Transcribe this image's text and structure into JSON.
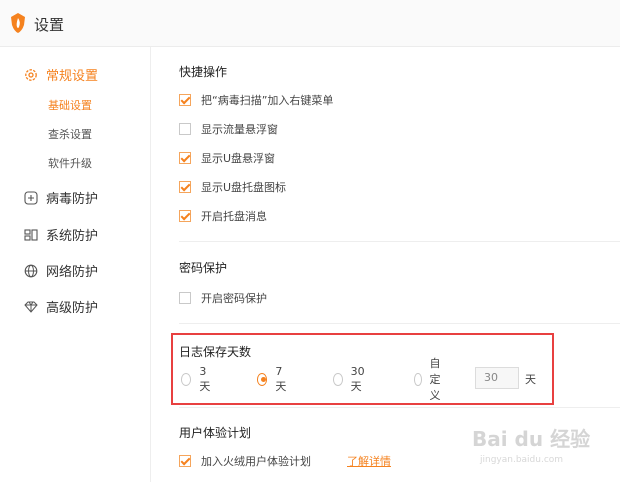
{
  "app": {
    "title": "设置"
  },
  "sidebar": {
    "items": [
      {
        "label": "常规设置",
        "icon": "gear-icon"
      },
      {
        "label": "病毒防护",
        "icon": "plus-box-icon"
      },
      {
        "label": "系统防护",
        "icon": "grid-icon"
      },
      {
        "label": "网络防护",
        "icon": "globe-icon"
      },
      {
        "label": "高级防护",
        "icon": "diamond-icon"
      }
    ],
    "subitems": [
      "基础设置",
      "查杀设置",
      "软件升级"
    ]
  },
  "shortcuts": {
    "title": "快捷操作",
    "options": [
      {
        "label": "把“病毒扫描”加入右键菜单",
        "checked": true
      },
      {
        "label": "显示流量悬浮窗",
        "checked": false
      },
      {
        "label": "显示U盘悬浮窗",
        "checked": true
      },
      {
        "label": "显示U盘托盘图标",
        "checked": true
      },
      {
        "label": "开启托盘消息",
        "checked": true
      }
    ]
  },
  "password": {
    "title": "密码保护",
    "option": {
      "label": "开启密码保护",
      "checked": false
    }
  },
  "log": {
    "title": "日志保存天数",
    "options": [
      "3天",
      "7天",
      "30天",
      "自定义"
    ],
    "selected": "7天",
    "custom_value": "30",
    "unit": "天"
  },
  "experience": {
    "title": "用户体验计划",
    "option": {
      "label": "加入火绒用户体验计划",
      "checked": true
    },
    "link": "了解详情"
  },
  "watermark": {
    "main": "Bai du 经验",
    "sub": "jingyan.baidu.com"
  },
  "colors": {
    "accent": "#f5821f",
    "highlight": "#e84040"
  }
}
